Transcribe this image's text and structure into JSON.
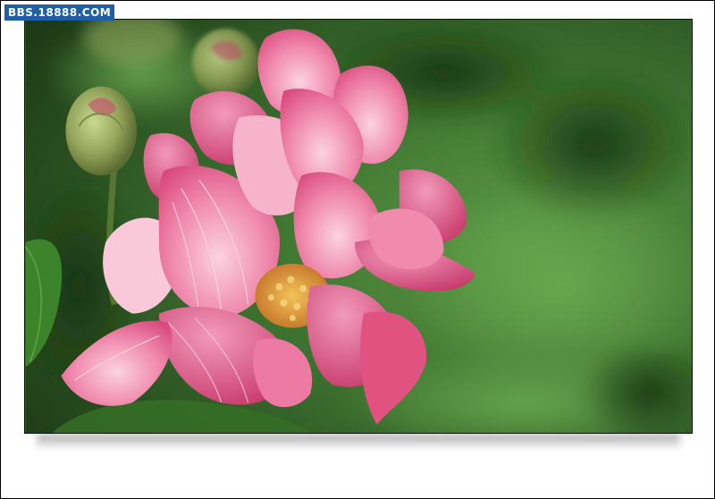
{
  "watermark": {
    "text": "BBS.18888.COM"
  },
  "photo": {
    "subject": "pink-flower",
    "colors": {
      "petal": "#e8638f",
      "petal_light": "#f6b4cb",
      "petal_dark": "#c93a6a",
      "stamen": "#e3a540",
      "foliage": "#3f7a30",
      "foliage_dark": "#1f4417"
    }
  }
}
